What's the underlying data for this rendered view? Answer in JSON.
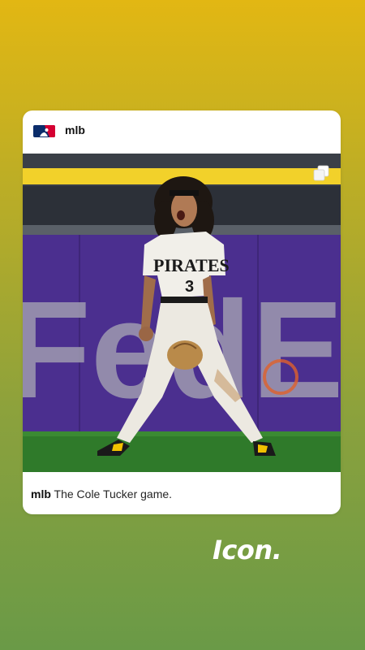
{
  "post": {
    "username": "mlb",
    "caption_user": "mlb",
    "caption_text": "The Cole Tucker game.",
    "photo": {
      "jersey_text": "PIRATES",
      "jersey_number": "3",
      "wall_ad": "FedEx"
    }
  },
  "sticker": {
    "text": "Icon."
  },
  "icons": {
    "logo": "mlb-logo-icon",
    "multi": "multiple-images-icon"
  },
  "colors": {
    "background_top": "#e2b713",
    "background_bottom": "#6a9a47",
    "wall_purple": "#4b2f8f",
    "grass": "#2f7a2a",
    "mlb_blue": "#0b2d6b",
    "mlb_red": "#d50032"
  }
}
